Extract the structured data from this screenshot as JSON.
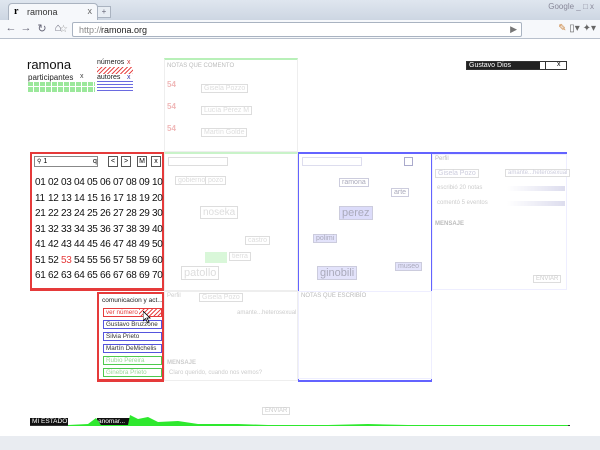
{
  "browser": {
    "tab_title": "ramona",
    "tab_favicon": "r",
    "tab_close": "x",
    "new_tab": "+",
    "url_scheme": "http://",
    "url_host": "ramona.org",
    "window_controls": "Google _ □ x"
  },
  "app": {
    "logo": "ramona",
    "numeros_label": "números",
    "numeros_close": "x",
    "participantes_label": "participantes",
    "participantes_close": "x",
    "autores_label": "autores",
    "autores_close": "x",
    "user_name": "Gustavo Dios",
    "user_close": "x"
  },
  "notas_comento": {
    "title": "NOTAS QUE COMENTO",
    "items": [
      {
        "num": "54",
        "line1": "....",
        "link": "Gisela Pozzo"
      },
      {
        "num": "54",
        "line1": "....",
        "link": "Lucía Pérez M"
      },
      {
        "num": "54",
        "line1": "....",
        "link": "Martín Golde"
      }
    ]
  },
  "numbers_panel": {
    "search_value": "1",
    "search_key": "q",
    "prev": "<",
    "next": ">",
    "mode": "M",
    "close": "x",
    "rows": [
      [
        "01",
        "02",
        "03",
        "04",
        "05",
        "06",
        "07",
        "08",
        "09",
        "10"
      ],
      [
        "11",
        "12",
        "13",
        "14",
        "15",
        "16",
        "17",
        "18",
        "19",
        "20"
      ],
      [
        "21",
        "22",
        "23",
        "24",
        "25",
        "26",
        "27",
        "28",
        "29",
        "30"
      ],
      [
        "31",
        "32",
        "33",
        "34",
        "35",
        "36",
        "37",
        "38",
        "39",
        "40"
      ],
      [
        "41",
        "42",
        "43",
        "44",
        "45",
        "46",
        "47",
        "48",
        "49",
        "50"
      ],
      [
        "51",
        "52",
        "53",
        "54",
        "55",
        "56",
        "57",
        "58",
        "59",
        "60"
      ],
      [
        "61",
        "62",
        "63",
        "64",
        "65",
        "66",
        "67",
        "68",
        "69",
        "70"
      ]
    ],
    "selected": "53"
  },
  "authors_panel": {
    "title": "comunicacion y act...",
    "items": [
      {
        "name": "ver número",
        "color": "#e53a3a"
      },
      {
        "name": "Gustavo Bruzzone",
        "color": "#5555dd"
      },
      {
        "name": "Silvia Prieto",
        "color": "#5555dd"
      },
      {
        "name": "Martín DeMichelis",
        "color": "#5555dd"
      },
      {
        "name": "Rubio Pereira",
        "color": "#4ec94e"
      },
      {
        "name": "Ginebra Prieto",
        "color": "#4ec94e"
      }
    ]
  },
  "tag_clouds": {
    "green": [
      "gobierno",
      "pozo",
      "noseka",
      "patollo",
      "castro",
      "tierra"
    ],
    "blue": [
      "ramona",
      "perez",
      "ginobili",
      "polimi",
      "arte",
      "museo"
    ]
  },
  "profile": {
    "title": "Perfil",
    "name": "Gisela Pozo",
    "tag": "amante...heterosexual",
    "stat1": "escribió 20 notas",
    "stat2": "comentó 5 eventos",
    "message_title": "MENSAJE",
    "send": "ENVIAR"
  },
  "notas_escribo": {
    "title": "NOTAS QUE ESCRIBÍO"
  },
  "mensaje2": {
    "title": "MENSAJE",
    "body": "Claro querido, cuando nos vemos?",
    "send": "ENVIAR"
  },
  "status": {
    "mi_estado": "MI ESTADO",
    "state_value": "anomar..."
  }
}
